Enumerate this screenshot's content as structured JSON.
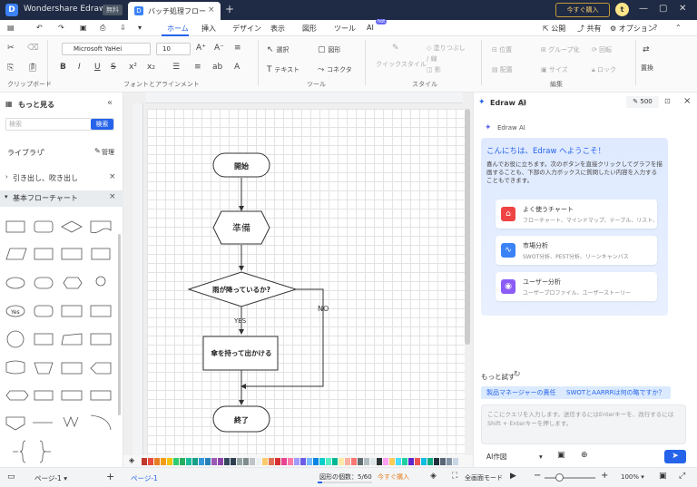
{
  "titlebar": {
    "logo": "D",
    "app_title": "Wondershare EdrawMax",
    "free_badge": "無料",
    "doc_icon": "D",
    "doc_tab": "バッチ処理フロー",
    "buy": "今すぐ購入",
    "avatar": "t"
  },
  "menu": {
    "items": [
      "ホーム",
      "挿入",
      "デザイン",
      "表示",
      "図形",
      "ツール",
      "AI"
    ],
    "active": "ホーム",
    "hot": "hot",
    "right": [
      "公開",
      "共有",
      "オプション"
    ]
  },
  "ribbon": {
    "font": "Microsoft YaHei",
    "size": "10",
    "groups": {
      "clipboard": "クリップボード",
      "font": "フォントとアラインメント",
      "tools": "ツール",
      "style": "スタイル",
      "edit": "編集"
    },
    "tools": {
      "select": "選択",
      "shape": "図形",
      "text": "テキスト",
      "connector": "コネクタ"
    },
    "style": {
      "quick": "クイックスタイル",
      "fill": "塗りつぶし",
      "line": "線",
      "shadow": "影"
    },
    "edit": {
      "position": "位置",
      "group": "グループ化",
      "rotate": "回転",
      "arrange": "配置",
      "size": "サイズ",
      "lock": "ロック",
      "replace": "置換"
    }
  },
  "sidebar": {
    "title": "もっと見る",
    "search_placeholder": "検索",
    "search_btn": "検索",
    "library": "ライブラリ",
    "manage": "管理",
    "cat1": "引き出し、吹き出し",
    "cat2": "基本フローチャート",
    "yes_shape": "Yes"
  },
  "flowchart": {
    "start": "開始",
    "prep": "準備",
    "decision": "雨が降っているか?",
    "yes": "YES",
    "no": "NO",
    "process": "傘を持って出かける",
    "end": "終了"
  },
  "ai": {
    "title": "Edraw AI",
    "credits": "500",
    "sub": "Edraw AI",
    "greeting": "こんにちは、Edraw へようこそ！",
    "intro": "喜んでお役に立ちます。次のボタンを直接クリックしてグラフを描画することも、下部の入力ボックスに質問したい内容を入力することもできます。",
    "cards": [
      {
        "title": "よく使うチャート",
        "desc": "フローチャート、マインドマップ、テーブル、リスト、タイムライン",
        "color": "#ef4444"
      },
      {
        "title": "市場分析",
        "desc": "SWOT分析、PEST分析、リーンキャンバス",
        "color": "#3b82f6"
      },
      {
        "title": "ユーザー分析",
        "desc": "ユーザープロファイル、ユーザーストーリー",
        "color": "#8b5cf6"
      }
    ],
    "more": "もっと試す",
    "chips": [
      "製品マネージャーの責任",
      "SWOTとAARRRは何の略ですか？"
    ],
    "input_placeholder": "ここにクエリを入力します。送信するにはEnterキーを、改行するにはShift + Enterキーを押します。",
    "mode": "AI作図"
  },
  "status": {
    "page_sel": "ページ-1",
    "page_tab": "ページ-1",
    "shape_count": "図形の個数：5/60",
    "buy": "今すぐ購入",
    "focus": "全画面モード",
    "zoom": "100%"
  },
  "colors": [
    "#c0392b",
    "#e74c3c",
    "#e67e22",
    "#f39c12",
    "#f1c40f",
    "#2ecc71",
    "#27ae60",
    "#1abc9c",
    "#16a085",
    "#3498db",
    "#2980b9",
    "#9b59b6",
    "#8e44ad",
    "#34495e",
    "#2c3e50",
    "#95a5a6",
    "#7f8c8d",
    "#bdc3c7",
    "#ecf0f1",
    "#fdcb6e",
    "#e17055",
    "#d63031",
    "#e84393",
    "#fd79a8",
    "#a29bfe",
    "#6c5ce7",
    "#74b9ff",
    "#0984e3",
    "#00cec9",
    "#55efc4",
    "#00b894",
    "#ffeaa7",
    "#fab1a0",
    "#ff7675",
    "#636e72",
    "#b2bec3",
    "#dfe6e9",
    "#2d3436",
    "#ff9ff3",
    "#feca57",
    "#48dbfb",
    "#1dd1a1",
    "#5f27cd",
    "#ee5253",
    "#0abde3",
    "#10ac84",
    "#222f3e",
    "#576574",
    "#8395a7",
    "#c8d6e5"
  ]
}
